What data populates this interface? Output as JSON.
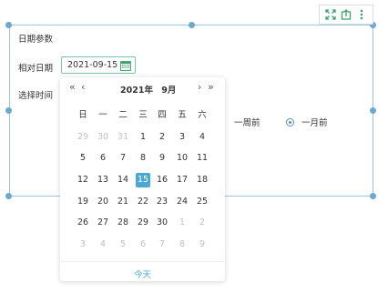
{
  "toolbar": {
    "icons": [
      "expand-icon",
      "export-icon",
      "more-icon"
    ]
  },
  "panel": {
    "title": "日期参数",
    "relative_date_label": "相对日期",
    "date_value": "2021-09-15",
    "select_time_label": "选择时间",
    "radio_one_week": "一周前",
    "radio_one_month": "一月前",
    "selected_radio": "一月前"
  },
  "calendar": {
    "year": "2021年",
    "month": "9月",
    "weekdays": [
      "日",
      "一",
      "二",
      "三",
      "四",
      "五",
      "六"
    ],
    "weeks": [
      [
        "29",
        "30",
        "31",
        "1",
        "2",
        "3",
        "4"
      ],
      [
        "5",
        "6",
        "7",
        "8",
        "9",
        "10",
        "11"
      ],
      [
        "12",
        "13",
        "14",
        "15",
        "16",
        "17",
        "18"
      ],
      [
        "19",
        "20",
        "21",
        "22",
        "23",
        "24",
        "25"
      ],
      [
        "26",
        "27",
        "28",
        "29",
        "30",
        "1",
        "2"
      ],
      [
        "3",
        "4",
        "5",
        "6",
        "7",
        "8",
        "9"
      ]
    ],
    "muted": [
      [
        true,
        true,
        true,
        false,
        false,
        false,
        false
      ],
      [
        false,
        false,
        false,
        false,
        false,
        false,
        false
      ],
      [
        false,
        false,
        false,
        false,
        false,
        false,
        false
      ],
      [
        false,
        false,
        false,
        false,
        false,
        false,
        false
      ],
      [
        false,
        false,
        false,
        false,
        false,
        true,
        true
      ],
      [
        true,
        true,
        true,
        true,
        true,
        true,
        true
      ]
    ],
    "selected_day": "15",
    "today_label": "今天"
  },
  "colors": {
    "accent": "#4aa8d4",
    "frame": "#9cc4dc",
    "input_border": "#7cc3a8",
    "toolbar_green": "#3aa26a"
  }
}
